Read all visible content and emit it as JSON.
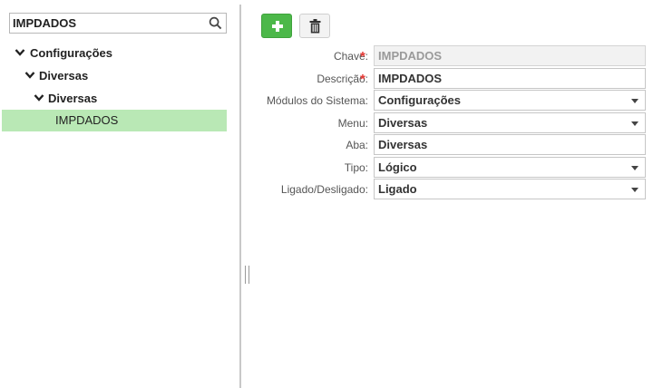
{
  "search": {
    "value": "IMPDADOS"
  },
  "tree": {
    "level1": "Configurações",
    "level2": "Diversas",
    "level3": "Diversas",
    "selected": "IMPDADOS"
  },
  "colors": {
    "add_button": "#4cb849",
    "selected_row": "#b9e8b5",
    "required": "#e53935"
  },
  "form": {
    "chave": {
      "label": "Chave:",
      "value": "IMPDADOS"
    },
    "descricao": {
      "label": "Descrição:",
      "value": "IMPDADOS"
    },
    "modulos": {
      "label": "Módulos do Sistema:",
      "value": "Configurações"
    },
    "menu": {
      "label": "Menu:",
      "value": "Diversas"
    },
    "aba": {
      "label": "Aba:",
      "value": "Diversas"
    },
    "tipo": {
      "label": "Tipo:",
      "value": "Lógico"
    },
    "ligado": {
      "label": "Ligado/Desligado:",
      "value": "Ligado"
    },
    "required_mark": "*"
  }
}
